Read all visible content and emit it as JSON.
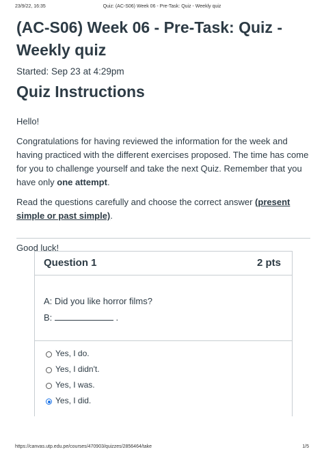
{
  "print": {
    "datetime": "23/9/22, 16:35",
    "doc_title": "Quiz: (AC-S06) Week 06 - Pre-Task: Quiz - Weekly quiz",
    "url": "https://canvas.utp.edu.pe/courses/470903/quizzes/2856464/take",
    "page": "1/5"
  },
  "quiz": {
    "title": "(AC-S06) Week 06 - Pre-Task: Quiz - Weekly quiz",
    "started": "Started: Sep 23 at 4:29pm"
  },
  "instructions": {
    "heading": "Quiz Instructions",
    "hello": "Hello!",
    "p1_text": "Congratulations for having reviewed the information for the week and having practiced with the different exercises proposed. The time has come for you to challenge yourself and take the next Quiz. Remember that you have only ",
    "p1_bold": "one attempt",
    "p1_end": ".",
    "p2_text": "Read the questions carefully and choose the correct answer ",
    "p2_bold_underline": "(present simple or past simple)",
    "p2_end": ".",
    "good_luck": "Good luck!"
  },
  "question": {
    "name": "Question 1",
    "points": "2 pts",
    "line1": "A: Did you like horror films?",
    "line2_prefix": "B:",
    "line2_suffix": ".",
    "answers": [
      {
        "label": "Yes, I do.",
        "selected": false
      },
      {
        "label": "Yes, I didn't.",
        "selected": false
      },
      {
        "label": "Yes, I was.",
        "selected": false
      },
      {
        "label": "Yes, I did.",
        "selected": true
      }
    ]
  },
  "colors": {
    "text": "#2d3b45",
    "border": "#c7cdd1",
    "radio_selected": "#1a73e8"
  }
}
